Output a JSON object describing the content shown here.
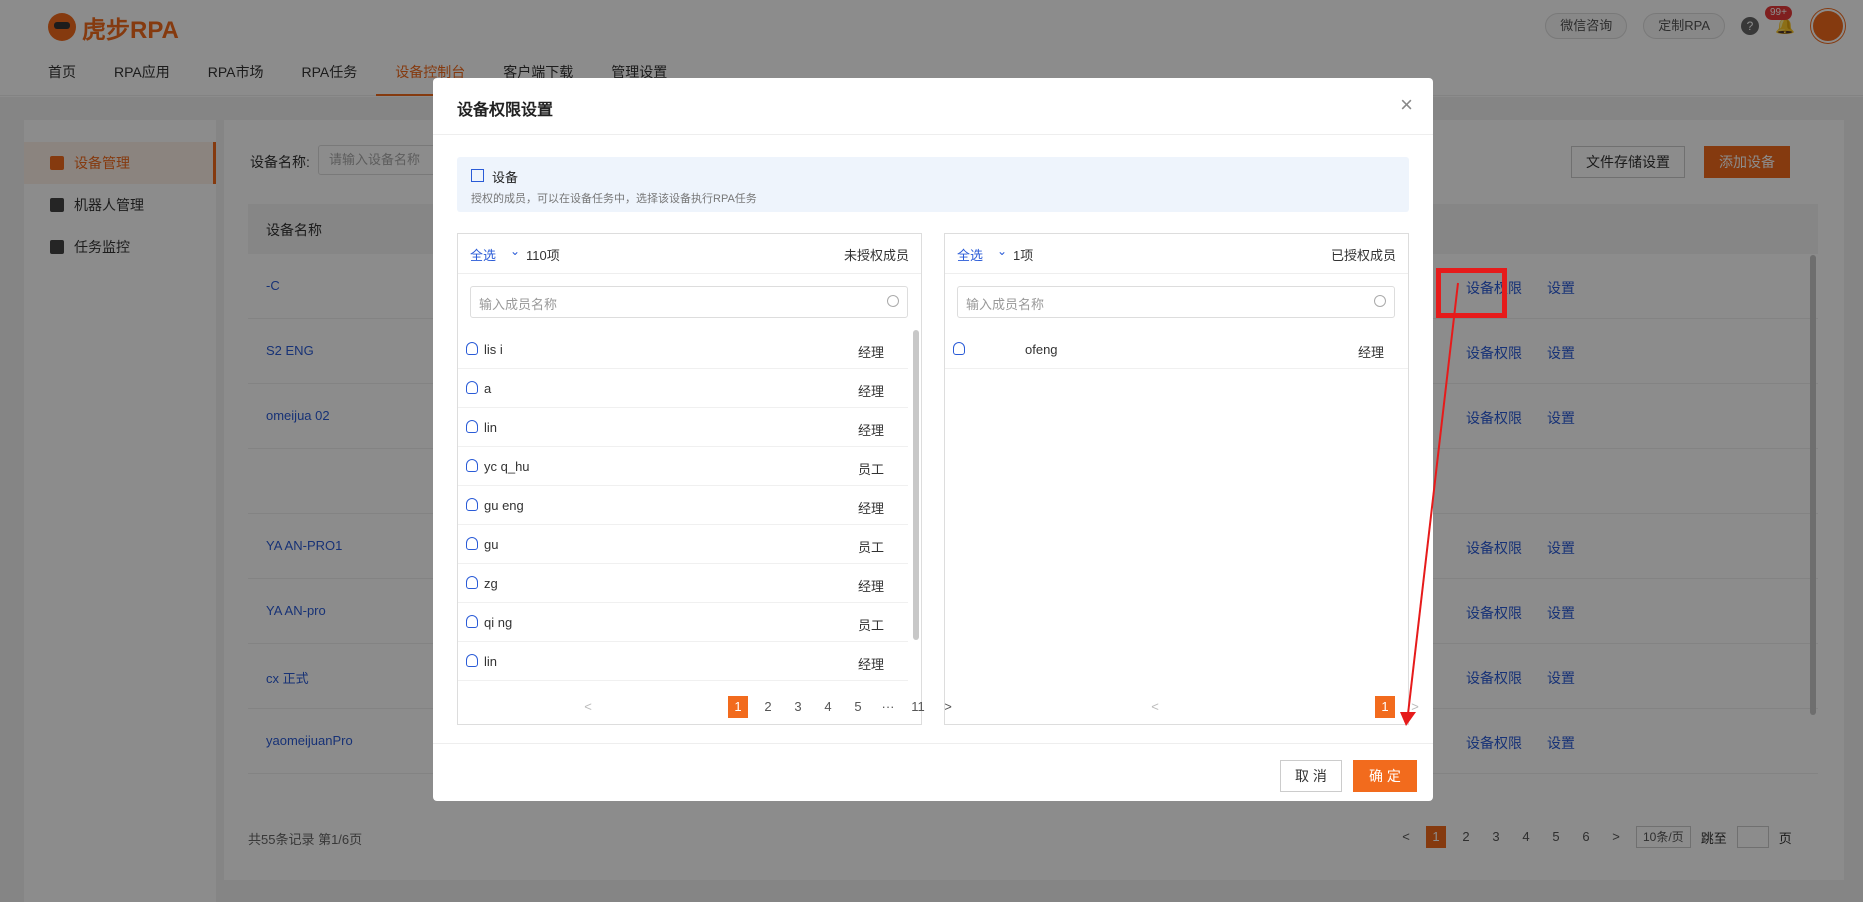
{
  "app": {
    "logo_text": "虎步RPA"
  },
  "nav": [
    "首页",
    "RPA应用",
    "RPA市场",
    "RPA任务",
    "设备控制台",
    "客户端下载",
    "管理设置"
  ],
  "nav_active_index": 4,
  "topbar": {
    "wechat": "微信咨询",
    "custom": "定制RPA",
    "help_icon": "?",
    "notify_badge": "99+"
  },
  "sidebar": {
    "items": [
      "设备管理",
      "机器人管理",
      "任务监控"
    ]
  },
  "filter": {
    "label": "设备名称:",
    "placeholder": "请输入设备名称"
  },
  "buttons": {
    "file_storage": "文件存储设置",
    "add_device": "添加设备"
  },
  "table": {
    "header": "设备名称",
    "rows": [
      {
        "name": "-C",
        "action1": "设备权限",
        "action2": "设置"
      },
      {
        "name": "S2 ENG",
        "action1": "设备权限",
        "action2": "设置"
      },
      {
        "name": "omeijua 02",
        "action1": "设备权限",
        "action2": "设置"
      },
      {
        "name": "",
        "action1": "",
        "action2": ""
      },
      {
        "name": "YA AN-PRO1",
        "action1": "设备权限",
        "action2": "设置"
      },
      {
        "name": "YA AN-pro",
        "action1": "设备权限",
        "action2": "设置"
      },
      {
        "name": "cx 正式",
        "action1": "设备权限",
        "action2": "设置"
      },
      {
        "name": "yaomeijuanPro",
        "action1": "设备权限",
        "action2": "设置"
      }
    ]
  },
  "footer": {
    "info": "共55条记录 第1/6页",
    "pages": [
      "1",
      "2",
      "3",
      "4",
      "5",
      "6"
    ],
    "prev": "<",
    "next": ">",
    "page_size": "10条/页",
    "jump_label": "跳至",
    "jump_unit": "页"
  },
  "modal": {
    "title": "设备权限设置",
    "close": "×",
    "device_label": "设备",
    "device_desc": "授权的成员，可以在设备任务中，选择该设备执行RPA任务",
    "left": {
      "select_all": "全选",
      "count": "110项",
      "title": "未授权成员",
      "search_placeholder": "输入成员名称",
      "members": [
        {
          "name": "lis i",
          "role": "经理"
        },
        {
          "name": "a",
          "role": "经理"
        },
        {
          "name": "lin",
          "role": "经理"
        },
        {
          "name": "yc q_hu",
          "role": "员工"
        },
        {
          "name": "gu eng",
          "role": "经理"
        },
        {
          "name": "gu",
          "role": "员工"
        },
        {
          "name": "zg",
          "role": "经理"
        },
        {
          "name": "qi ng",
          "role": "员工"
        },
        {
          "name": "lin",
          "role": "经理"
        }
      ],
      "pages": [
        "1",
        "2",
        "3",
        "4",
        "5",
        "···",
        "11"
      ],
      "prev": "<",
      "next": ">"
    },
    "right": {
      "select_all": "全选",
      "count": "1项",
      "title": "已授权成员",
      "search_placeholder": "输入成员名称",
      "members": [
        {
          "name": "ofeng",
          "role": "经理"
        }
      ],
      "pages": [
        "1"
      ],
      "prev": "<",
      "next": ">"
    },
    "cancel": "取 消",
    "ok": "确 定"
  },
  "colors": {
    "accent": "#f26b1d",
    "link": "#2a5bd7",
    "highlight": "#e61b1b"
  }
}
